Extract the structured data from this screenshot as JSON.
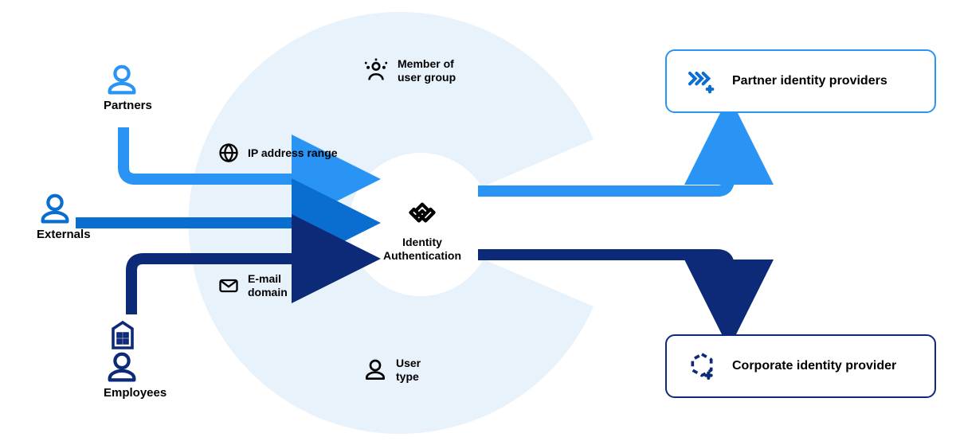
{
  "colors": {
    "light": "#2a94f4",
    "medium": "#0a6ed1",
    "dark": "#0d2a78",
    "bg": "#e8f2fb"
  },
  "actors": {
    "partners": "Partners",
    "externals": "Externals",
    "employees": "Employees"
  },
  "rules": {
    "member_of": "Member of\nuser group",
    "ip_range": "IP address range",
    "email_domain": "E-mail\ndomain",
    "user_type": "User\ntype"
  },
  "center": "Identity\nAuthentication",
  "providers": {
    "partner": "Partner identity providers",
    "corporate": "Corporate identity provider"
  }
}
